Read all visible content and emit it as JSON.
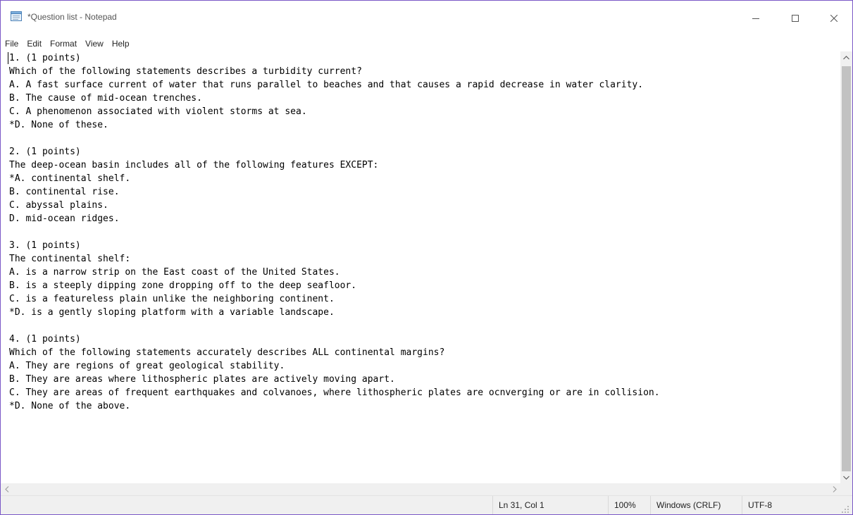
{
  "window": {
    "title": "*Question list - Notepad"
  },
  "icons": {
    "app": "notepad-icon",
    "minimize": "minimize-icon",
    "maximize": "maximize-icon",
    "close": "close-icon"
  },
  "menu": [
    "File",
    "Edit",
    "Format",
    "View",
    "Help"
  ],
  "document": {
    "lines": [
      "1. (1 points)",
      "Which of the following statements describes a turbidity current?",
      "A. A fast surface current of water that runs parallel to beaches and that causes a rapid decrease in water clarity.",
      "B. The cause of mid-ocean trenches.",
      "C. A phenomenon associated with violent storms at sea.",
      "*D. None of these.",
      "",
      "2. (1 points)",
      "The deep-ocean basin includes all of the following features EXCEPT:",
      "*A. continental shelf.",
      "B. continental rise.",
      "C. abyssal plains.",
      "D. mid-ocean ridges.",
      "",
      "3. (1 points)",
      "The continental shelf:",
      "A. is a narrow strip on the East coast of the United States.",
      "B. is a steeply dipping zone dropping off to the deep seafloor.",
      "C. is a featureless plain unlike the neighboring continent.",
      "*D. is a gently sloping platform with a variable landscape.",
      "",
      "4. (1 points)",
      "Which of the following statements accurately describes ALL continental margins?",
      "A. They are regions of great geological stability.",
      "B. They are areas where lithospheric plates are actively moving apart.",
      "C. They are areas of frequent earthquakes and colvanoes, where lithospheric plates are ocnverging or are in collision.",
      "*D. None of the above."
    ]
  },
  "status": {
    "position": "Ln 31, Col 1",
    "zoom": "100%",
    "line_ending": "Windows (CRLF)",
    "encoding": "UTF-8"
  },
  "colors": {
    "window_border": "#7b58c7",
    "scroll_thumb": "#c2c2c2",
    "statusbar_bg": "#f0f0f0"
  }
}
